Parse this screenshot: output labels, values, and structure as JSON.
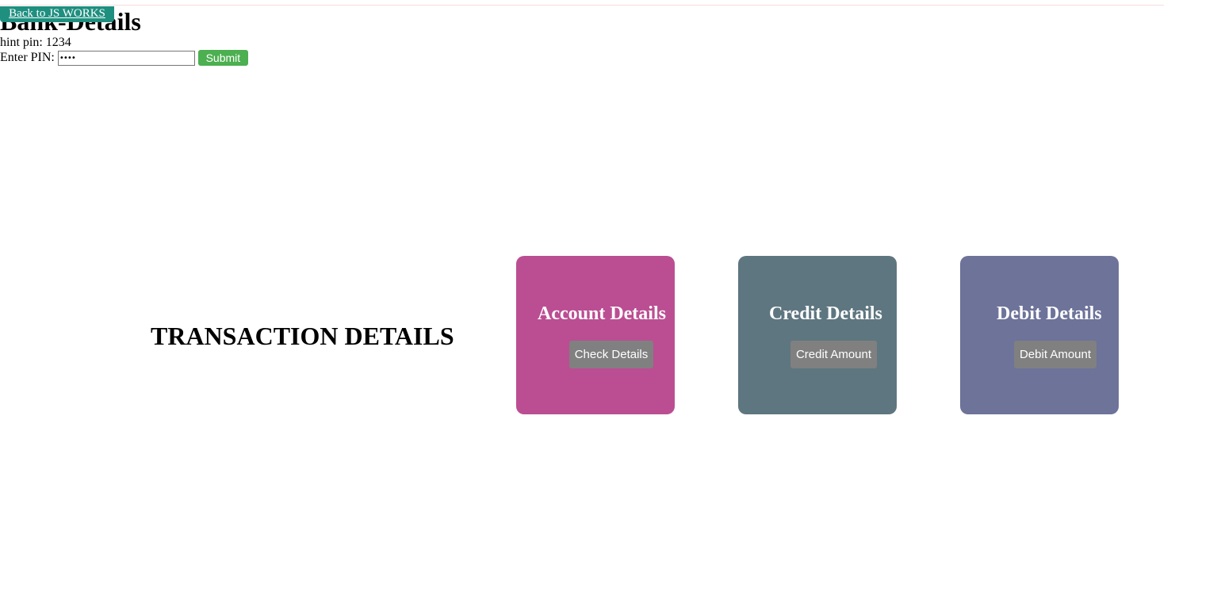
{
  "nav": {
    "back_label": "Back to JS WORKS"
  },
  "header": {
    "title": "Bank-Details"
  },
  "pin": {
    "hint": "hint pin: 1234",
    "label": "Enter PIN:",
    "value": "••••",
    "submit_label": "Submit"
  },
  "main": {
    "section_title": "TRANSACTION DETAILS",
    "cards": [
      {
        "title": "Account Details",
        "button": "Check Details",
        "color": "#bb4e92"
      },
      {
        "title": "Credit Details",
        "button": "Credit Amount",
        "color": "#5e7680"
      },
      {
        "title": "Debit Details",
        "button": "Debit Amount",
        "color": "#6d7399"
      }
    ]
  },
  "colors": {
    "back_link_bg": "#1f8f80",
    "submit_bg": "#4caf50",
    "card_button_bg": "#808080"
  }
}
